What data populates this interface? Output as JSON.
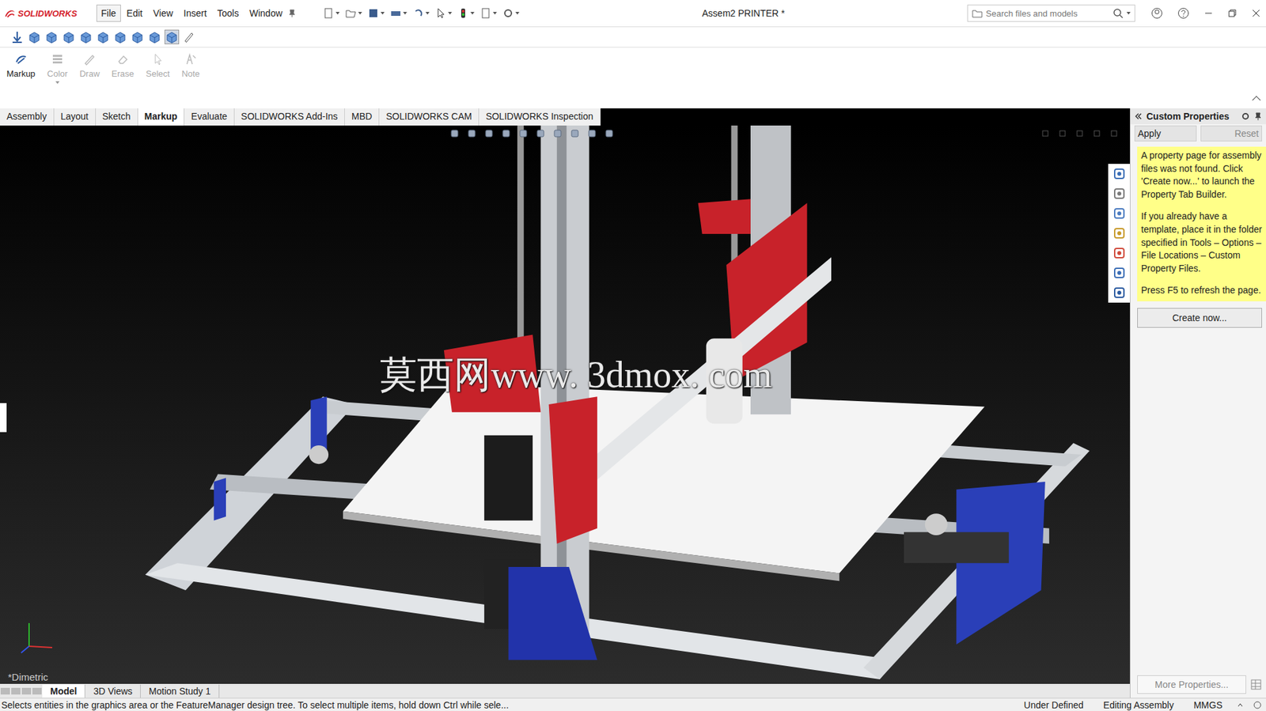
{
  "window": {
    "title": "Assem2 PRINTER *"
  },
  "logo": {
    "text": "SOLIDWORKS"
  },
  "menus": [
    {
      "label": "File",
      "selected": true
    },
    {
      "label": "Edit",
      "selected": false
    },
    {
      "label": "View",
      "selected": false
    },
    {
      "label": "Insert",
      "selected": false
    },
    {
      "label": "Tools",
      "selected": false
    },
    {
      "label": "Window",
      "selected": false
    }
  ],
  "search": {
    "placeholder": "Search files and models"
  },
  "commands": [
    {
      "label": "Markup",
      "disabled": false
    },
    {
      "label": "Color",
      "disabled": true
    },
    {
      "label": "Draw",
      "disabled": true
    },
    {
      "label": "Erase",
      "disabled": true
    },
    {
      "label": "Select",
      "disabled": true
    },
    {
      "label": "Note",
      "disabled": true
    }
  ],
  "tabs": [
    {
      "label": "Assembly",
      "selected": false
    },
    {
      "label": "Layout",
      "selected": false
    },
    {
      "label": "Sketch",
      "selected": false
    },
    {
      "label": "Markup",
      "selected": true
    },
    {
      "label": "Evaluate",
      "selected": false
    },
    {
      "label": "SOLIDWORKS Add-Ins",
      "selected": false
    },
    {
      "label": "MBD",
      "selected": false
    },
    {
      "label": "SOLIDWORKS CAM",
      "selected": false
    },
    {
      "label": "SOLIDWORKS Inspection",
      "selected": false
    }
  ],
  "viewport": {
    "view_label": "*Dimetric",
    "watermark": "莫西网www. 3dmox. com"
  },
  "panel": {
    "title": "Custom Properties",
    "apply": "Apply",
    "reset": "Reset",
    "note": [
      "A property page for assembly files was not found. Click 'Create now...' to launch the Property Tab Builder.",
      "If you already have a template, place it in the folder specified in Tools – Options – File Locations – Custom Property Files.",
      "Press F5 to refresh the page."
    ],
    "create_button": "Create now...",
    "more_button": "More Properties..."
  },
  "bottom_tabs": [
    {
      "label": "Model",
      "selected": true
    },
    {
      "label": "3D Views",
      "selected": false
    },
    {
      "label": "Motion Study 1",
      "selected": false
    }
  ],
  "status_bar": {
    "message": "Selects entities in the graphics area or the FeatureManager design tree. To select multiple items, hold down Ctrl while sele...",
    "items": [
      "Under Defined",
      "Editing Assembly",
      "MMGS"
    ]
  }
}
